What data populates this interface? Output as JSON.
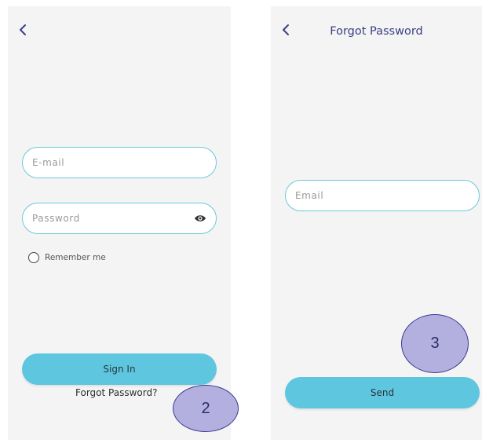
{
  "signin_screen": {
    "email_placeholder": "E-mail",
    "password_placeholder": "Password",
    "remember_label": "Remember me",
    "signin_label": "Sign In",
    "forgot_link": "Forgot Password?"
  },
  "forgot_screen": {
    "title": "Forgot Password",
    "email_placeholder": "Email",
    "send_label": "Send"
  },
  "annotations": {
    "step_2": "2",
    "step_3": "3"
  },
  "icons": {
    "back": "chevron-left-icon",
    "eye": "eye-icon",
    "radio": "radio-unchecked"
  },
  "colors": {
    "screen_bg": "#f4f4f4",
    "accent": "#5ec6de",
    "field_border": "#6cc9d9",
    "back_chevron": "#3b3f86",
    "badge_fill": "#b3b0e0",
    "badge_border": "#3e3a94"
  }
}
